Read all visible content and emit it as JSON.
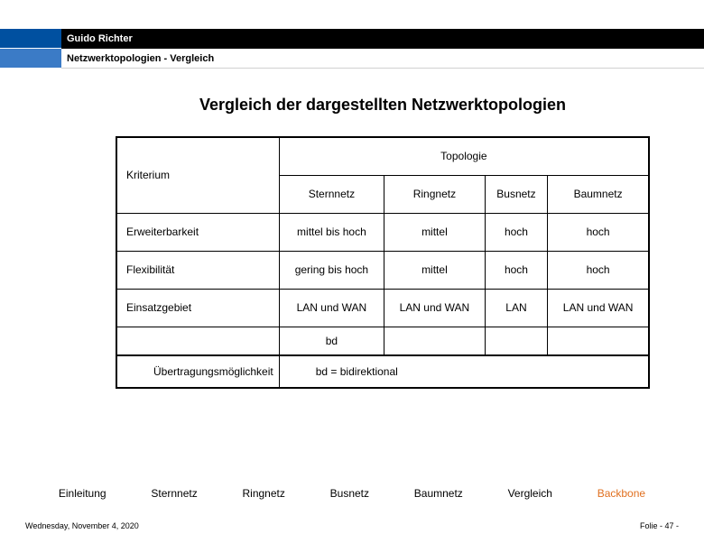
{
  "header": {
    "author": "Guido Richter",
    "subtitle": "Netzwerktopologien  - Vergleich"
  },
  "title": "Vergleich der dargestellten Netzwerktopologien",
  "table": {
    "criterion_label": "Kriterium",
    "topology_label": "Topologie",
    "columns": [
      "Sternnetz",
      "Ringnetz",
      "Busnetz",
      "Baumnetz"
    ],
    "rows": [
      {
        "label": "Erweiterbarkeit",
        "cells": [
          "mittel bis hoch",
          "mittel",
          "hoch",
          "hoch"
        ]
      },
      {
        "label": "Flexibilität",
        "cells": [
          "gering bis hoch",
          "mittel",
          "hoch",
          "hoch"
        ]
      },
      {
        "label": "Einsatzgebiet",
        "cells": [
          "LAN und WAN",
          "LAN und WAN",
          "LAN",
          "LAN und WAN"
        ]
      }
    ],
    "bd_cell": "bd",
    "legend_row_label": "Übertragungsmöglichkeit",
    "legend": "bd = bidirektional"
  },
  "nav": {
    "items": [
      "Einleitung",
      "Sternnetz",
      "Ringnetz",
      "Busnetz",
      "Baumnetz",
      "Vergleich",
      "Backbone"
    ],
    "active": "Backbone"
  },
  "footer": {
    "date": "Wednesday, November 4, 2020",
    "page": "Folie - 47 -"
  }
}
